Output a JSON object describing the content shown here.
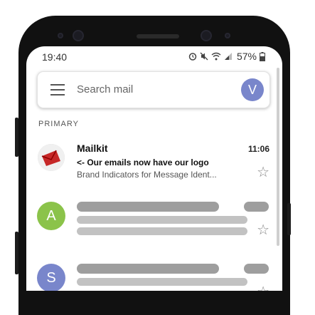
{
  "status_bar": {
    "time": "19:40",
    "battery_percent": "57%"
  },
  "search": {
    "placeholder": "Search mail",
    "account_initial": "V"
  },
  "section_label": "PRIMARY",
  "emails": [
    {
      "sender": "Mailkit",
      "subject": "<- Our emails now have our logo",
      "snippet": "Brand Indicators for Message Ident...",
      "time": "11:06"
    }
  ],
  "placeholder_rows": [
    {
      "initial": "A",
      "color": "#8bc34a"
    },
    {
      "initial": "S",
      "color": "#7986cb"
    }
  ],
  "icons": {
    "menu": "hamburger-menu-icon",
    "star": "star-outline-icon",
    "alarm": "alarm-icon",
    "mute": "mute-icon",
    "wifi": "wifi-icon",
    "signal": "signal-icon",
    "battery": "battery-icon"
  }
}
